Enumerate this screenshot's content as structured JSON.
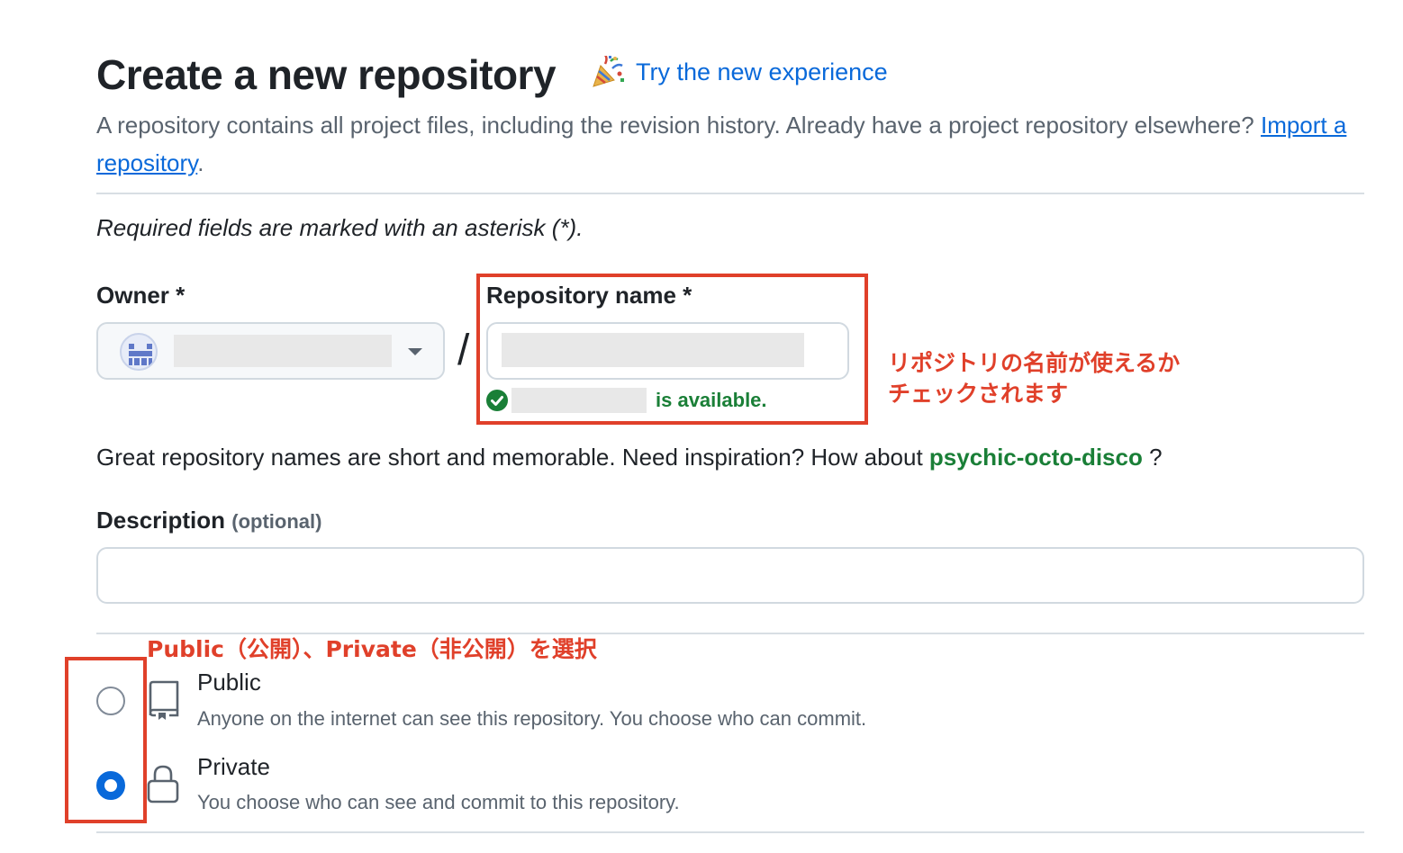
{
  "header": {
    "title": "Create a new repository",
    "try_link": "Try the new experience",
    "try_icon": "party-popper-icon",
    "intro_text": "A repository contains all project files, including the revision history. Already have a project repository elsewhere? ",
    "import_link": "Import a repository",
    "intro_end": "."
  },
  "required_note": "Required fields are marked with an asterisk (*).",
  "owner": {
    "label": "Owner *",
    "value": "",
    "avatar_icon": "avatar-identicon",
    "caret_icon": "triangle-down-icon"
  },
  "separator": "/",
  "repo_name": {
    "label": "Repository name *",
    "value": "",
    "availability": "is available.",
    "status_icon": "check-circle-fill-icon"
  },
  "name_hint": {
    "text": "Great repository names are short and memorable. Need inspiration? How about ",
    "suggestion": "psychic-octo-disco",
    "end": " ?"
  },
  "description": {
    "label": "Description",
    "optional": "(optional)",
    "value": ""
  },
  "visibility": {
    "options": [
      {
        "label": "Public",
        "description": "Anyone on the internet can see this repository. You choose who can commit.",
        "icon": "repo-icon",
        "selected": false
      },
      {
        "label": "Private",
        "description": "You choose who can see and commit to this repository.",
        "icon": "lock-icon",
        "selected": true
      }
    ]
  },
  "annotations": {
    "repo_name_note_line1": "リポジトリの名前が使えるか",
    "repo_name_note_line2": "チェックされます",
    "visibility_note": "Public（公開）、Private（非公開）を選択",
    "color": "#e0402a"
  },
  "colors": {
    "link": "#0969da",
    "success": "#1a7f37",
    "text": "#1f2328",
    "muted": "#59636e",
    "border": "#d1d9e0"
  }
}
